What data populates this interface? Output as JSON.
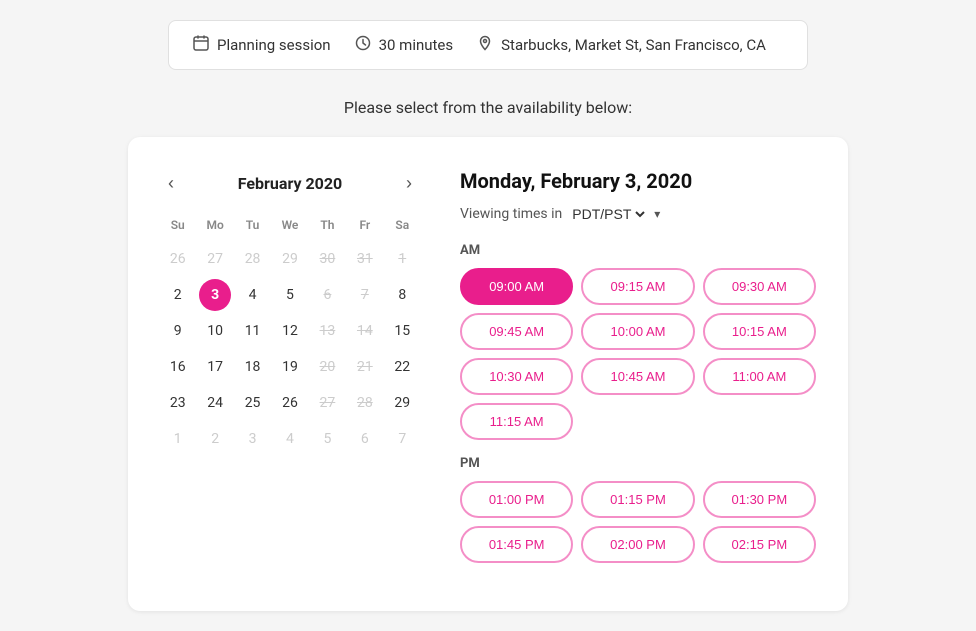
{
  "infoBar": {
    "eventIcon": "📋",
    "eventName": "Planning session",
    "durationIcon": "🕐",
    "duration": "30 minutes",
    "locationIcon": "📍",
    "location": "Starbucks, Market St, San Francisco, CA"
  },
  "subtitle": "Please select from the availability below:",
  "calendar": {
    "title": "February 2020",
    "prevLabel": "‹",
    "nextLabel": "›",
    "dayHeaders": [
      "Su",
      "Mo",
      "Tu",
      "We",
      "Th",
      "Fr",
      "Sa"
    ],
    "weeks": [
      [
        {
          "day": "26",
          "type": "other-month"
        },
        {
          "day": "27",
          "type": "other-month"
        },
        {
          "day": "28",
          "type": "other-month"
        },
        {
          "day": "29",
          "type": "other-month"
        },
        {
          "day": "30",
          "type": "strikethrough"
        },
        {
          "day": "31",
          "type": "strikethrough"
        },
        {
          "day": "1",
          "type": "strikethrough"
        }
      ],
      [
        {
          "day": "2",
          "type": "available"
        },
        {
          "day": "3",
          "type": "selected"
        },
        {
          "day": "4",
          "type": "available"
        },
        {
          "day": "5",
          "type": "available"
        },
        {
          "day": "6",
          "type": "strikethrough"
        },
        {
          "day": "7",
          "type": "strikethrough"
        },
        {
          "day": "8",
          "type": "available"
        }
      ],
      [
        {
          "day": "9",
          "type": "available"
        },
        {
          "day": "10",
          "type": "available"
        },
        {
          "day": "11",
          "type": "available"
        },
        {
          "day": "12",
          "type": "available"
        },
        {
          "day": "13",
          "type": "strikethrough"
        },
        {
          "day": "14",
          "type": "strikethrough"
        },
        {
          "day": "15",
          "type": "available"
        }
      ],
      [
        {
          "day": "16",
          "type": "available"
        },
        {
          "day": "17",
          "type": "available"
        },
        {
          "day": "18",
          "type": "available"
        },
        {
          "day": "19",
          "type": "available"
        },
        {
          "day": "20",
          "type": "strikethrough"
        },
        {
          "day": "21",
          "type": "strikethrough"
        },
        {
          "day": "22",
          "type": "available"
        }
      ],
      [
        {
          "day": "23",
          "type": "available"
        },
        {
          "day": "24",
          "type": "available"
        },
        {
          "day": "25",
          "type": "available"
        },
        {
          "day": "26",
          "type": "available"
        },
        {
          "day": "27",
          "type": "strikethrough"
        },
        {
          "day": "28",
          "type": "strikethrough"
        },
        {
          "day": "29",
          "type": "available"
        }
      ],
      [
        {
          "day": "1",
          "type": "other-month"
        },
        {
          "day": "2",
          "type": "other-month"
        },
        {
          "day": "3",
          "type": "other-month"
        },
        {
          "day": "4",
          "type": "other-month"
        },
        {
          "day": "5",
          "type": "other-month"
        },
        {
          "day": "6",
          "type": "other-month"
        },
        {
          "day": "7",
          "type": "other-month"
        }
      ]
    ]
  },
  "timePanel": {
    "title": "Monday, February 3, 2020",
    "viewingLabel": "Viewing times in",
    "timezone": "PDT/PST",
    "amLabel": "AM",
    "pmLabel": "PM",
    "amSlots": [
      "09:00 AM",
      "09:15 AM",
      "09:30 AM",
      "09:45 AM",
      "10:00 AM",
      "10:15 AM",
      "10:30 AM",
      "10:45 AM",
      "11:00 AM",
      "11:15 AM"
    ],
    "pmSlots": [
      "01:00 PM",
      "01:15 PM",
      "01:30 PM",
      "01:45 PM",
      "02:00 PM",
      "02:15 PM"
    ],
    "selectedSlot": "09:00 AM"
  }
}
